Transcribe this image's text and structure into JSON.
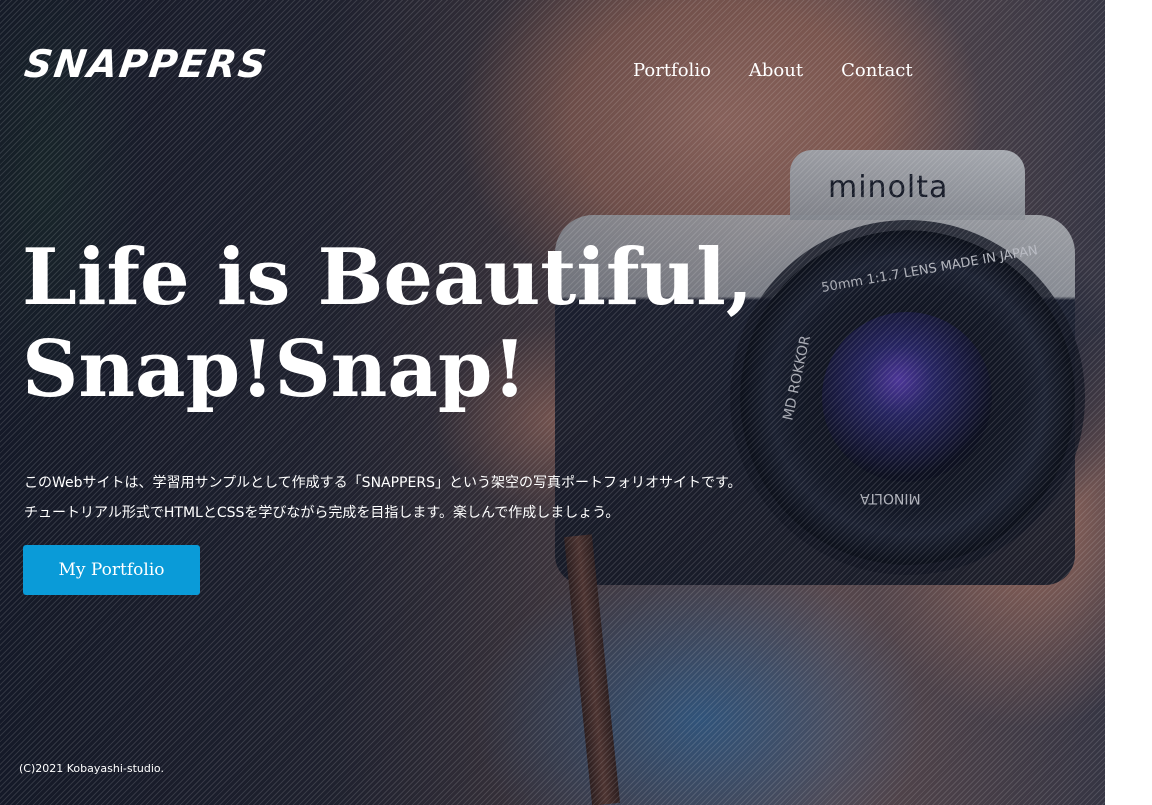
{
  "site": {
    "logo": "SNAPPERS"
  },
  "nav": {
    "items": [
      "Portfolio",
      "About",
      "Contact"
    ]
  },
  "hero": {
    "headline_line1": "Life is Beautiful,",
    "headline_line2": "Snap!Snap!",
    "description_line1": "このWebサイトは、学習用サンプルとして作成する「SNAPPERS」という架空の写真ポートフォリオサイトです。",
    "description_line2": "チュートリアル形式でHTMLとCSSを学びながら完成を目指します。楽しんで作成しましょう。",
    "cta_label": "My Portfolio",
    "camera_brand": "minolta",
    "lens_text_top": "50mm 1:1.7  LENS MADE IN JAPAN",
    "lens_text_side": "MD ROKKOR",
    "lens_text_bottom": "MINOLTA"
  },
  "footer": {
    "copyright": "(C)2021 Kobayashi-studio."
  },
  "colors": {
    "accent": "#0a9bd8",
    "text": "#ffffff"
  }
}
